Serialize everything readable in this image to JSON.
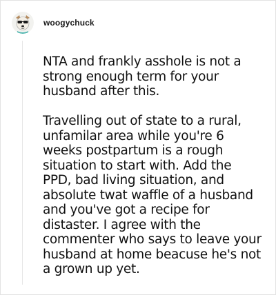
{
  "comment": {
    "username": "woogychuck",
    "avatar_icon": "dog-with-sunglasses-avatar",
    "paragraphs": [
      "NTA and frankly asshole is not a strong enough term for your husband after this.",
      "Travelling out of state to a rural, unfamilar area while you're 6 weeks postpartum is a rough situation to start with. Add the PPD, bad living situation, and absolute twat waffle of a husband and you've got a recipe for distaster. I agree with the commenter who says to leave your husband at home beacuse he's not a grown up yet."
    ]
  },
  "colors": {
    "text": "#111111",
    "border": "#e3e3e3",
    "thread_line": "#e6e6e6"
  }
}
